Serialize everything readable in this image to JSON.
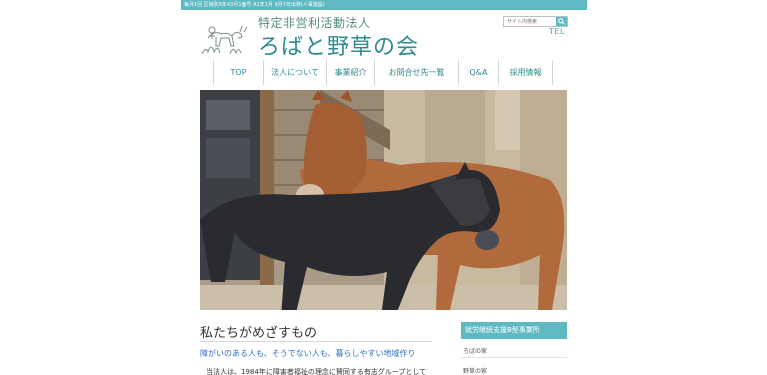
{
  "topbar": {
    "text": "毎月1回 区域別3年43月1面号 A1年1月 9月7日出発(人事施設)"
  },
  "logo": {
    "sub": "特定非営利活動法人",
    "main": "ろばと野草の会"
  },
  "search": {
    "placeholder": "サイト内検索"
  },
  "header": {
    "tel": "TEL"
  },
  "nav": {
    "items": [
      {
        "label": "TOP"
      },
      {
        "label": "法人について"
      },
      {
        "label": "事業紹介"
      },
      {
        "label": "お問合せ先一覧"
      },
      {
        "label": "Q&A"
      },
      {
        "label": "採用情報"
      }
    ]
  },
  "main": {
    "section_title": "私たちがめざすもの",
    "tagline": "障がいのある人も、そうでない人も、暮らしやすい地域作り",
    "intro": "当法人は、1984年に障害者福祉の理念に賛同する有志グループとして"
  },
  "sidebar": {
    "heading": "就労継続支援B型事業所",
    "items": [
      {
        "label": "ろばの家"
      },
      {
        "label": "野草の家"
      }
    ]
  },
  "colors": {
    "accent": "#5fb9c2",
    "brand_text": "#2f8b8f",
    "link": "#2f6fc8"
  }
}
